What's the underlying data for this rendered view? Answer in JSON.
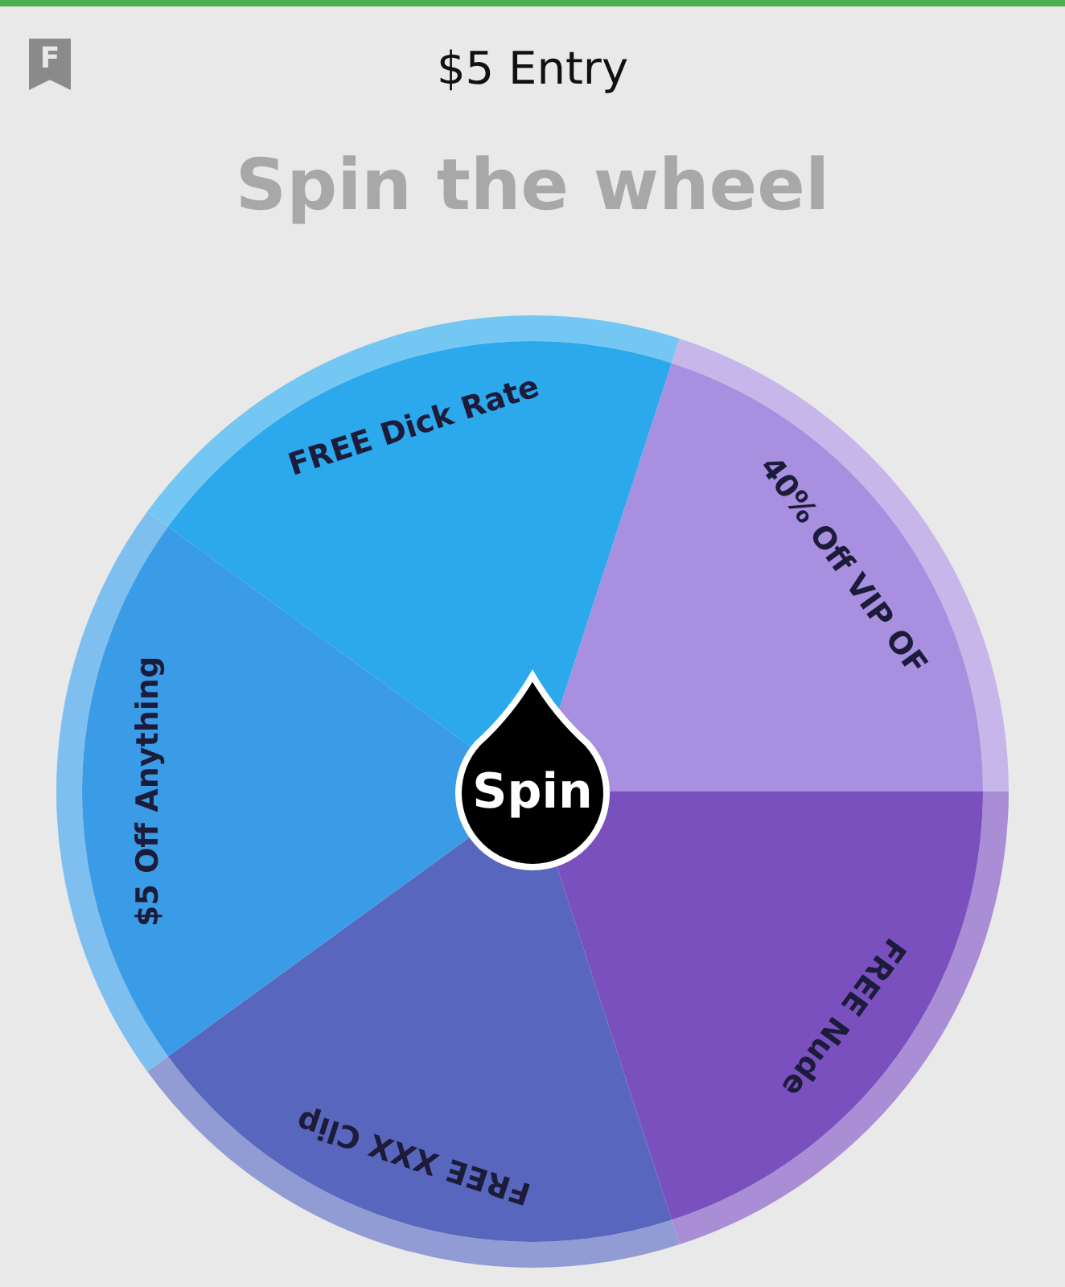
{
  "header": {
    "icon_letter": "F",
    "title": "$5 Entry"
  },
  "heading": "Spin the wheel",
  "wheel": {
    "button": "Spin",
    "segments": [
      {
        "label": "FREE Dick Rate",
        "color": "#2ba9ec"
      },
      {
        "label": "40% Off VIP OF",
        "color": "#a98fdf"
      },
      {
        "label": "FREE Nude",
        "color": "#7a50bf"
      },
      {
        "label": "FREE XXX Clip",
        "color": "#5866bd"
      },
      {
        "label": "$5 Off Anything",
        "color": "#3a9ce6"
      }
    ]
  }
}
